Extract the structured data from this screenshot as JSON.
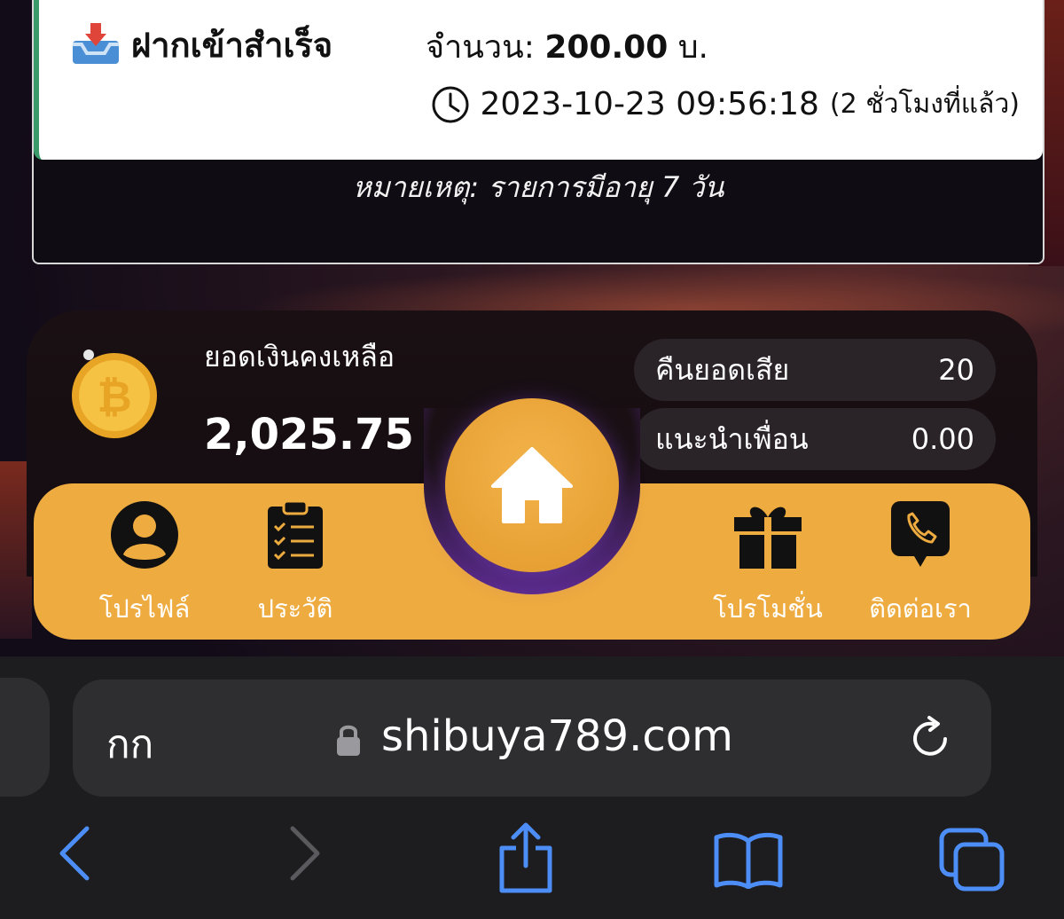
{
  "transaction": {
    "title": "ฝากเข้าสำเร็จ",
    "amount_label": "จำนวน:",
    "amount_value": "200.00",
    "amount_unit": "บ.",
    "timestamp": "2023-10-23 09:56:18",
    "relative_time": "(2 ชั่วโมงที่แล้ว)",
    "note": "หมายเหตุ: รายการมีอายุ 7 วัน",
    "accent_color": "#3a9a6a"
  },
  "wallet": {
    "balance_label": "ยอดเงินคงเหลือ",
    "balance_value": "2,025.75",
    "cashback_label": "คืนยอดเสีย",
    "cashback_value": "20",
    "referral_label": "แนะนำเพื่อน",
    "referral_value": "0.00"
  },
  "nav": {
    "accent_color": "#eeab3f",
    "items": [
      {
        "label": "โปรไฟล์",
        "icon": "user-icon"
      },
      {
        "label": "ประวัติ",
        "icon": "clipboard-icon"
      },
      {
        "label": "",
        "icon": "home-icon"
      },
      {
        "label": "โปรโมชั่น",
        "icon": "gift-icon"
      },
      {
        "label": "ติดต่อเรา",
        "icon": "phone-icon"
      }
    ]
  },
  "browser": {
    "text_size_label": "กก",
    "url": "shibuya789.com",
    "accent_color": "#4c8df6"
  }
}
